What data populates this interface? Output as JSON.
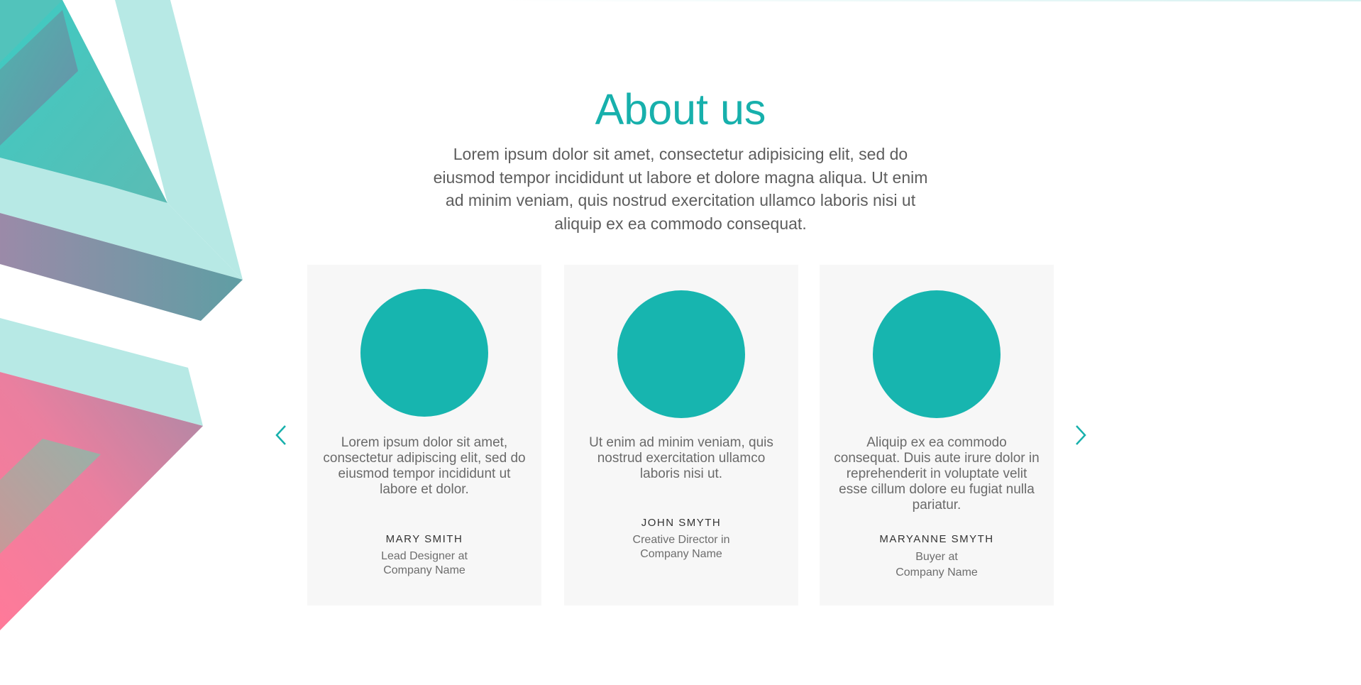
{
  "section": {
    "title": "About us",
    "intro": "Lorem ipsum dolor sit amet, consectetur adipisicing elit, sed do eiusmod tempor incididunt ut labore et dolore magna aliqua. Ut enim ad minim veniam, quis nostrud exercitation ullamco laboris nisi ut aliquip ex ea commodo consequat."
  },
  "carousel": {
    "prev_icon": "chevron-left-icon",
    "next_icon": "chevron-right-icon",
    "cards": [
      {
        "quote": "Lorem ipsum dolor sit amet, consectetur adipiscing elit, sed do eiusmod tempor incididunt ut labore et dolor.",
        "name": "MARY SMITH",
        "role_line1": "Lead Designer at",
        "role_line2": "Company Name"
      },
      {
        "quote": "Ut enim ad minim veniam, quis nostrud exercitation ullamco laboris nisi ut.",
        "name": "JOHN SMYTH",
        "role_line1": "Creative Director in",
        "role_line2": "Company Name"
      },
      {
        "quote": "Aliquip ex ea commodo consequat. Duis aute irure dolor in reprehenderit in voluptate velit esse cillum dolore eu fugiat nulla pariatur.",
        "name": "MARYANNE SMYTH",
        "role_line1": "Buyer at",
        "role_line2": "Company Name"
      }
    ]
  },
  "colors": {
    "accent": "#17b0ac",
    "avatar": "#17b5af",
    "card_bg": "#f7f7f7",
    "text": "#5d5d5d",
    "deco_pink": "#ff7596",
    "deco_light_teal": "#b6e8e5"
  }
}
